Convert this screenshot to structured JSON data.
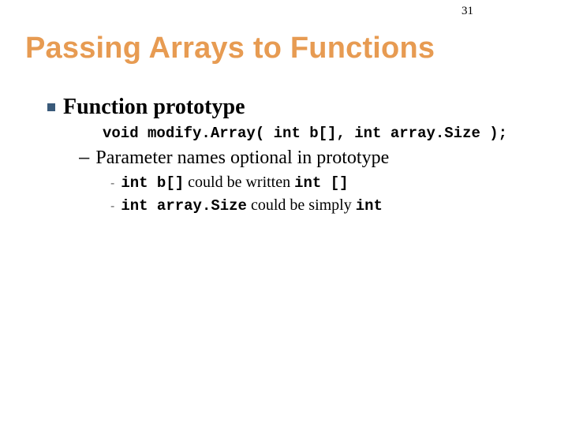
{
  "page_number": "31",
  "title": "Passing Arrays to Functions",
  "bullet1": "Function prototype",
  "prototype_line": "void modify.Array( int b[], int array.Size );",
  "bullet2": "Parameter names optional in prototype",
  "sub": {
    "a_code1": "int b[]",
    "a_mid": " could be written ",
    "a_code2": "int []",
    "b_code1": "int array.Size",
    "b_mid": " could be simply ",
    "b_code2": "int"
  }
}
